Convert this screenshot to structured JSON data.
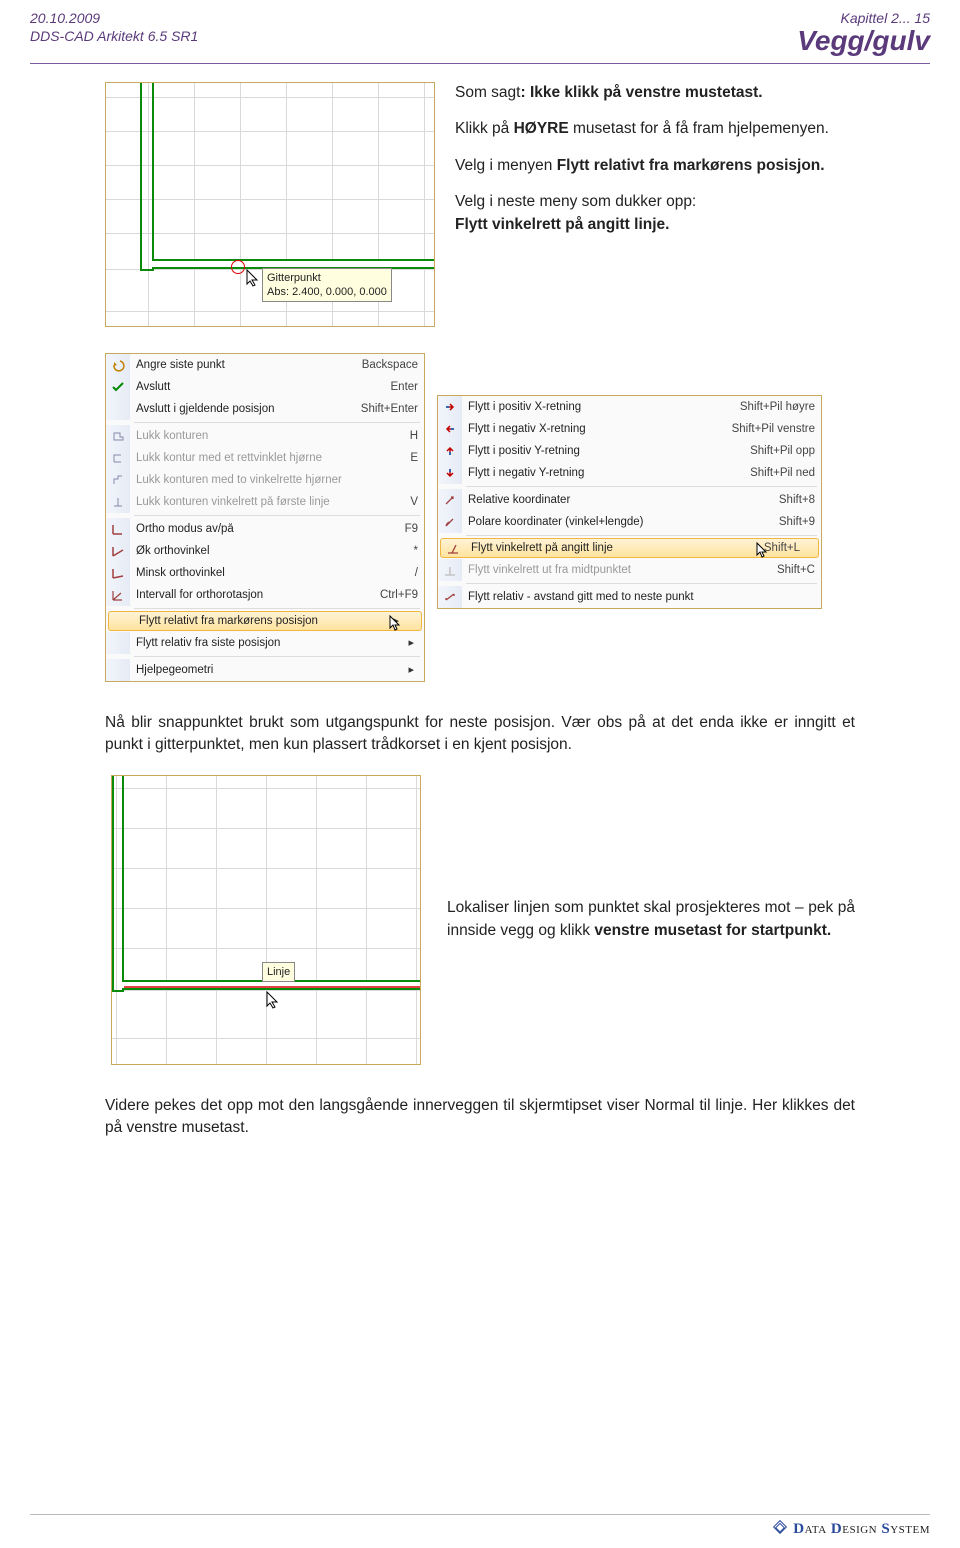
{
  "header": {
    "date": "20.10.2009",
    "product": "DDS-CAD Arkitekt  6.5  SR1",
    "chapter": "Kapittel 2...  15",
    "section": "Vegg/gulv"
  },
  "intro": {
    "line1a": "Som sagt",
    "line1b": ": Ikke klikk på venstre mustetast.",
    "para2a": "Klikk på ",
    "para2b": "HØYRE",
    "para2c": " musetast for å få fram hjelpemenyen.",
    "para3a": "Velg i menyen ",
    "para3b": "Flytt relativt fra markørens posisjon.",
    "para4a": "Velg i neste meny som dukker opp:",
    "para4b": "Flytt vinkelrett på angitt linje."
  },
  "fig1": {
    "tooltip_label": "Gitterpunkt",
    "tooltip_coords": "Abs: 2.400, 0.000, 0.000"
  },
  "menu1": {
    "items": [
      {
        "icon": "undo",
        "label": "Angre siste punkt",
        "short": "Backspace"
      },
      {
        "icon": "check",
        "label": "Avslutt",
        "short": "Enter"
      },
      {
        "icon": "",
        "label": "Avslutt i gjeldende posisjon",
        "short": "Shift+Enter"
      },
      {
        "sep": true
      },
      {
        "icon": "poly",
        "label": "Lukk konturen",
        "short": "H",
        "disabled": true
      },
      {
        "icon": "angle",
        "label": "Lukk kontur med et rettvinklet hjørne",
        "short": "E",
        "disabled": true
      },
      {
        "icon": "angle2",
        "label": "Lukk konturen med to vinkelrette hjørner",
        "short": "",
        "disabled": true
      },
      {
        "icon": "perp",
        "label": "Lukk konturen vinkelrett på første linje",
        "short": "V",
        "disabled": true
      },
      {
        "sep": true
      },
      {
        "icon": "ortho",
        "label": "Ortho modus av/på",
        "short": "F9"
      },
      {
        "icon": "inc",
        "label": "Øk orthovinkel",
        "short": "*"
      },
      {
        "icon": "dec",
        "label": "Minsk orthovinkel",
        "short": "/"
      },
      {
        "icon": "int",
        "label": "Intervall for orthorotasjon",
        "short": "Ctrl+F9"
      },
      {
        "sep": true
      },
      {
        "icon": "",
        "label": "Flytt relativt fra markørens posisjon",
        "short": "",
        "hi": true,
        "sub": true
      },
      {
        "icon": "",
        "label": "Flytt relativ fra siste posisjon",
        "short": "",
        "sub": true
      },
      {
        "sep": true
      },
      {
        "icon": "",
        "label": "Hjelpegeometri",
        "short": "",
        "sub": true
      }
    ]
  },
  "menu2": {
    "items": [
      {
        "icon": "rx",
        "label": "Flytt i positiv X-retning",
        "short": "Shift+Pil høyre"
      },
      {
        "icon": "lx",
        "label": "Flytt i negativ X-retning",
        "short": "Shift+Pil venstre"
      },
      {
        "icon": "uy",
        "label": "Flytt i positiv Y-retning",
        "short": "Shift+Pil opp"
      },
      {
        "icon": "dy",
        "label": "Flytt i negativ Y-retning",
        "short": "Shift+Pil ned"
      },
      {
        "sep": true
      },
      {
        "icon": "rel",
        "label": "Relative koordinater",
        "short": "Shift+8"
      },
      {
        "icon": "pol",
        "label": "Polare koordinater (vinkel+lengde)",
        "short": "Shift+9"
      },
      {
        "sep": true
      },
      {
        "icon": "perp2",
        "label": "Flytt vinkelrett på angitt linje",
        "short": "Shift+L",
        "hi": true
      },
      {
        "icon": "mid",
        "label": "Flytt vinkelrett ut fra midtpunktet",
        "short": "Shift+C",
        "disabled": true
      },
      {
        "sep": true
      },
      {
        "icon": "dist",
        "label": "Flytt relativ - avstand gitt med to neste punkt",
        "short": ""
      }
    ]
  },
  "para_mid": "Nå blir snappunktet brukt som utgangspunkt for neste posisjon. Vær obs på at det enda ikke er inngitt et punkt i gitterpunktet, men kun plassert trådkorset i en kjent posisjon.",
  "para_right": {
    "a": "Lokaliser linjen som punktet skal prosjekteres mot – pek på innside vegg og klikk ",
    "b": "venstre",
    "c": " ",
    "d": "musetast for startpunkt."
  },
  "fig2": {
    "tooltip": "Linje"
  },
  "para_bottom": "Videre pekes det opp mot den langsgående innerveggen til skjermtipset viser Normal til linje. Her klikkes det på venstre musetast.",
  "footer": {
    "brand_a": "D",
    "brand_b": "ata ",
    "brand_c": "D",
    "brand_d": "esign ",
    "brand_e": "S",
    "brand_f": "ystem"
  }
}
